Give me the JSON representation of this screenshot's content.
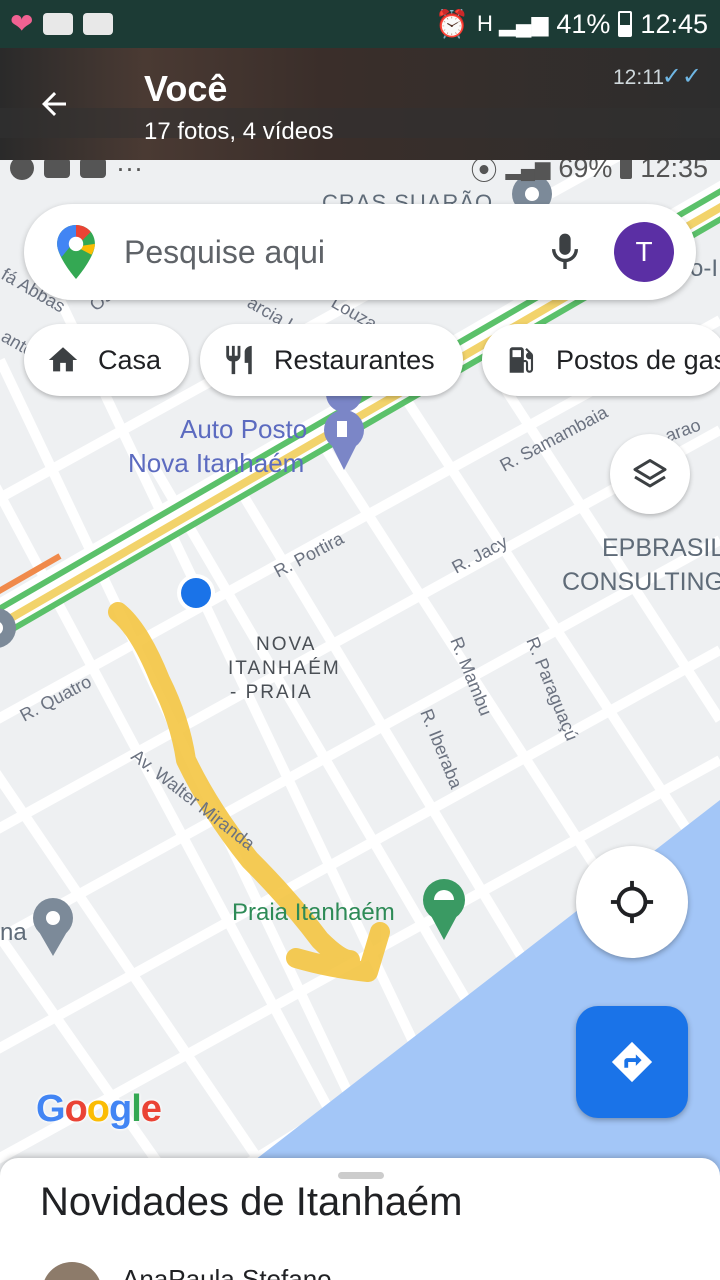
{
  "outer_status": {
    "battery": "41%",
    "time": "12:45"
  },
  "viewer": {
    "title": "Você",
    "subtitle": "17 fotos, 4 vídeos",
    "timestamp": "12:11"
  },
  "inner_status": {
    "dots": "···",
    "battery": "69%",
    "time": "12:35"
  },
  "search": {
    "placeholder": "Pesquise aqui",
    "avatar_letter": "T"
  },
  "chips": [
    {
      "label": "Casa",
      "icon": "home-icon"
    },
    {
      "label": "Restaurantes",
      "icon": "restaurant-icon"
    },
    {
      "label": "Postos de gas",
      "icon": "gas-station-icon"
    }
  ],
  "map": {
    "places": {
      "cras": "CRAS SUARÃO",
      "auto_posto_line1": "Auto Posto",
      "auto_posto_line2": "Nova Itanhaém",
      "epbrasil_line1": "EPBRASIL",
      "epbrasil_line2": "CONSULTING",
      "neighborhood_line1": "NOVA",
      "neighborhood_line2": "ITANHAÉM",
      "neighborhood_line3": "- PRAIA",
      "praia": "Praia Itanhaém",
      "left_edge": "na"
    },
    "streets": {
      "samambaia": "R. Samambaia",
      "portira": "R. Portira",
      "jacy": "R. Jacy",
      "quatro": "R. Quatro",
      "mambu": "R. Mambu",
      "paraguacu": "R. Paraguaçú",
      "iberaba": "R. Iberaba",
      "walter": "Av. Walter Miranda",
      "abbas": "fá Abbas",
      "sao": "Osa",
      "garcia": "arcia L",
      "souza": "Louza",
      "anto": "anto",
      "arao": "arao",
      "top_right": "o-I"
    },
    "water_color": "#a3c6f7",
    "annotation_color": "#f4c542"
  },
  "logo": {
    "text_G": "G",
    "text_o1": "o",
    "text_o2": "o",
    "text_g": "g",
    "text_l": "l",
    "text_e": "e"
  },
  "sheet": {
    "title": "Novidades de Itanhaém",
    "author": "AnaPaula Stefano"
  }
}
